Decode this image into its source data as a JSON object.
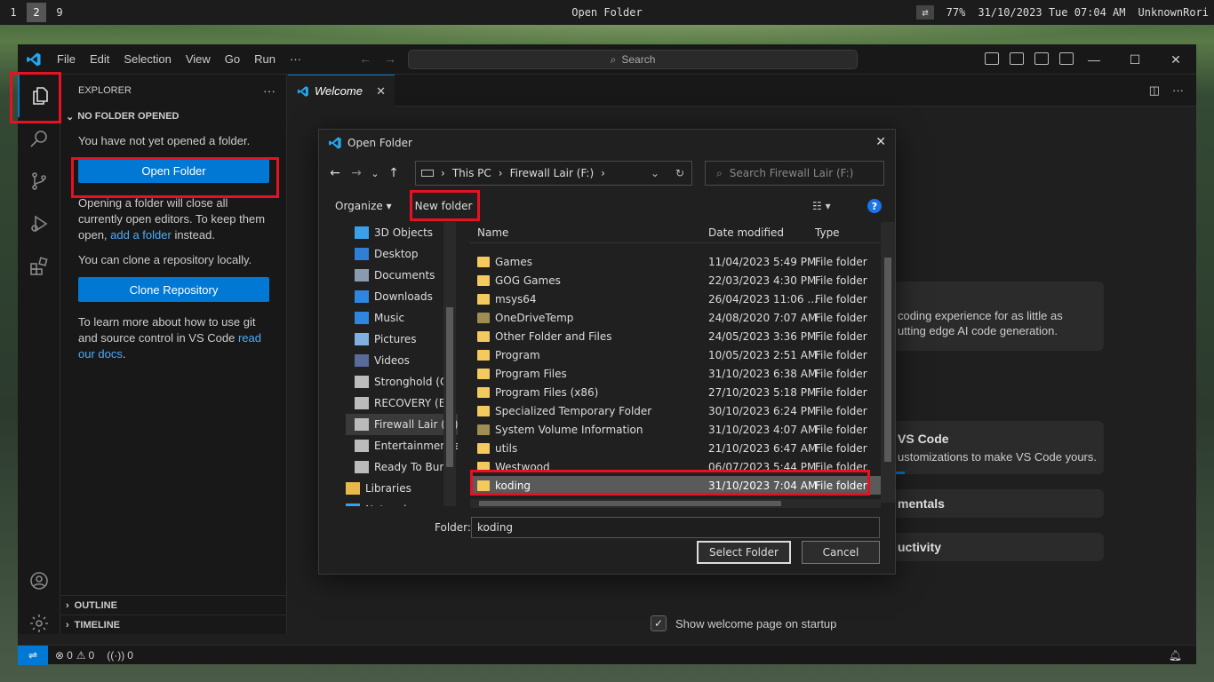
{
  "topbar": {
    "workspaces": [
      "1",
      "2",
      "9"
    ],
    "title": "Open Folder",
    "battery": "77%",
    "datetime": "31/10/2023 Tue 07:04 AM",
    "user": "UnknownRori"
  },
  "titlebar": {
    "menu": [
      "File",
      "Edit",
      "Selection",
      "View",
      "Go",
      "Run",
      "···"
    ],
    "search_placeholder": "Search"
  },
  "sidebar": {
    "header": "EXPLORER",
    "section": "NO FOLDER OPENED",
    "msg1": "You have not yet opened a folder.",
    "open_folder": "Open Folder",
    "msg2_a": "Opening a folder will close all currently open editors. To keep them open, ",
    "msg2_link": "add a folder",
    "msg2_b": " instead.",
    "msg3": "You can clone a repository locally.",
    "clone": "Clone Repository",
    "msg4_a": "To learn more about how to use git and source control in VS Code ",
    "msg4_link": "read our docs",
    "msg4_b": ".",
    "outline": "OUTLINE",
    "timeline": "TIMELINE"
  },
  "editor": {
    "tab": "Welcome",
    "card1_line1": "coding experience for as little as",
    "card1_line2": "utting edge AI code generation.",
    "card2_title": "VS Code",
    "card2_line": "ustomizations to make VS Code yours.",
    "card3_title": "mentals",
    "card4_title": "uctivity",
    "show_welcome": "Show welcome page on startup"
  },
  "status": {
    "errors": "0",
    "warnings": "0",
    "ports": "0"
  },
  "dialog": {
    "title": "Open Folder",
    "path": [
      "This PC",
      "Firewall Lair (F:)"
    ],
    "search_placeholder": "Search Firewall Lair (F:)",
    "organize": "Organize",
    "new_folder": "New folder",
    "tree": [
      {
        "label": "3D Objects",
        "color": "#3aa0e8"
      },
      {
        "label": "Desktop",
        "color": "#2f7fd6"
      },
      {
        "label": "Documents",
        "color": "#8a9bb0"
      },
      {
        "label": "Downloads",
        "color": "#2f86e0"
      },
      {
        "label": "Music",
        "color": "#2f86e0"
      },
      {
        "label": "Pictures",
        "color": "#7fb0e0"
      },
      {
        "label": "Videos",
        "color": "#5a6a9a"
      },
      {
        "label": "Stronghold (C:)",
        "color": "#bbbbbb"
      },
      {
        "label": "RECOVERY (E:)",
        "color": "#bbbbbb"
      },
      {
        "label": "Firewall Lair (F:)",
        "color": "#bbbbbb"
      },
      {
        "label": "Entertainment and",
        "color": "#bbbbbb"
      },
      {
        "label": "Ready To Burn",
        "color": "#bbbbbb"
      },
      {
        "label": "Libraries",
        "color": "#e8b84a"
      },
      {
        "label": "Network",
        "color": "#3aa0e8"
      }
    ],
    "columns": {
      "name": "Name",
      "date": "Date modified",
      "type": "Type"
    },
    "rows": [
      {
        "name": "Games",
        "date": "11/04/2023 5:49 PM",
        "type": "File folder"
      },
      {
        "name": "GOG Games",
        "date": "22/03/2023 4:30 PM",
        "type": "File folder"
      },
      {
        "name": "msys64",
        "date": "26/04/2023 11:06 ...",
        "type": "File folder"
      },
      {
        "name": "OneDriveTemp",
        "date": "24/08/2020 7:07 AM",
        "type": "File folder"
      },
      {
        "name": "Other Folder and Files",
        "date": "24/05/2023 3:36 PM",
        "type": "File folder"
      },
      {
        "name": "Program",
        "date": "10/05/2023 2:51 AM",
        "type": "File folder"
      },
      {
        "name": "Program Files",
        "date": "31/10/2023 6:38 AM",
        "type": "File folder"
      },
      {
        "name": "Program Files (x86)",
        "date": "27/10/2023 5:18 PM",
        "type": "File folder"
      },
      {
        "name": "Specialized Temporary Folder",
        "date": "30/10/2023 6:24 PM",
        "type": "File folder"
      },
      {
        "name": "System Volume Information",
        "date": "31/10/2023 4:07 AM",
        "type": "File folder"
      },
      {
        "name": "utils",
        "date": "21/10/2023 6:47 AM",
        "type": "File folder"
      },
      {
        "name": "Westwood",
        "date": "06/07/2023 5:44 PM",
        "type": "File folder"
      },
      {
        "name": "koding",
        "date": "31/10/2023 7:04 AM",
        "type": "File folder"
      }
    ],
    "folder_label": "Folder:",
    "folder_value": "koding",
    "select_btn": "Select Folder",
    "cancel_btn": "Cancel"
  }
}
